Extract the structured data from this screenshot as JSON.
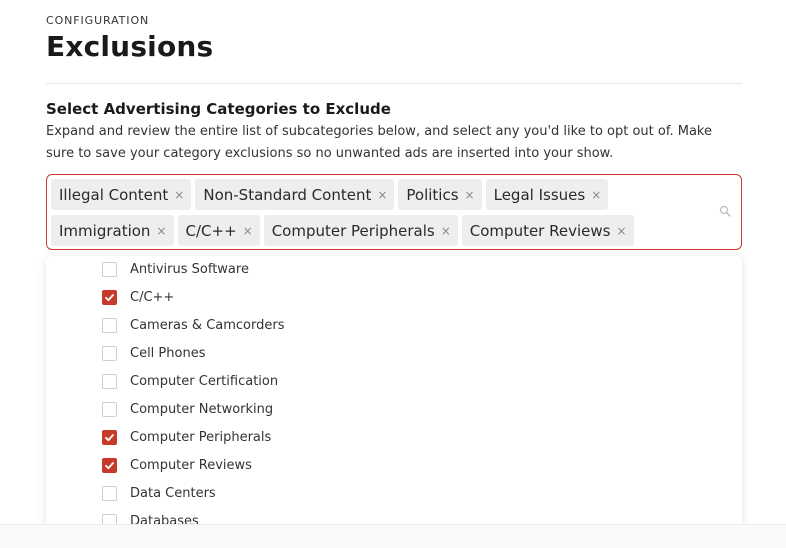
{
  "header": {
    "overline": "CONFIGURATION",
    "title": "Exclusions"
  },
  "section": {
    "title": "Select Advertising Categories to Exclude",
    "description": "Expand and review the entire list of subcategories below, and select any you'd like to opt out of. Make sure to save your category exclusions so no unwanted ads are inserted into your show."
  },
  "selected_chips": [
    {
      "label": "Illegal Content",
      "remove": "×"
    },
    {
      "label": "Non-Standard Content",
      "remove": "×"
    },
    {
      "label": "Politics",
      "remove": "×"
    },
    {
      "label": "Legal Issues",
      "remove": "×"
    },
    {
      "label": "Immigration",
      "remove": "×"
    },
    {
      "label": "C/C++",
      "remove": "×"
    },
    {
      "label": "Computer Peripherals",
      "remove": "×"
    },
    {
      "label": "Computer Reviews",
      "remove": "×"
    }
  ],
  "search_icon": "search-icon",
  "options": [
    {
      "label": "Antivirus Software",
      "checked": false
    },
    {
      "label": "C/C++",
      "checked": true
    },
    {
      "label": "Cameras & Camcorders",
      "checked": false
    },
    {
      "label": "Cell Phones",
      "checked": false
    },
    {
      "label": "Computer Certification",
      "checked": false
    },
    {
      "label": "Computer Networking",
      "checked": false
    },
    {
      "label": "Computer Peripherals",
      "checked": true
    },
    {
      "label": "Computer Reviews",
      "checked": true
    },
    {
      "label": "Data Centers",
      "checked": false
    },
    {
      "label": "Databases",
      "checked": false
    }
  ],
  "colors": {
    "accent": "#c73a2a",
    "chip_bg": "#eeeeee"
  }
}
